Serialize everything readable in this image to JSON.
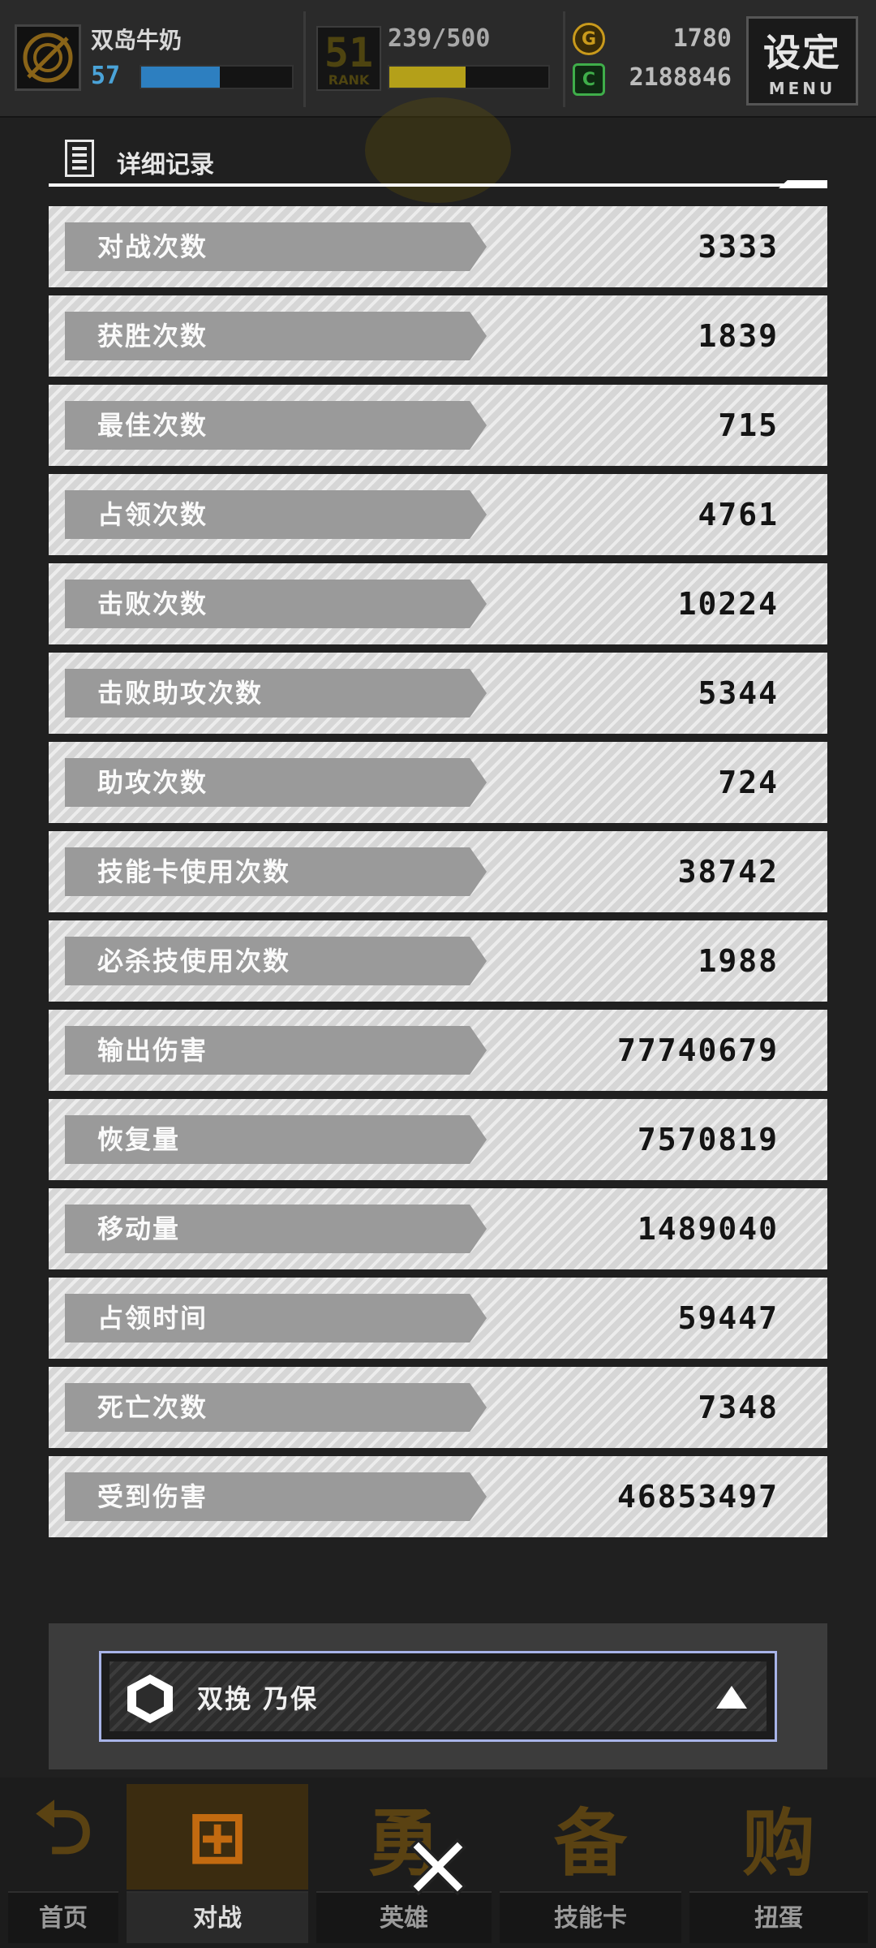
{
  "player": {
    "name": "双岛牛奶",
    "level": "57",
    "level_progress": 0.52
  },
  "rank": {
    "number": "51",
    "label": "RANK",
    "progress_text": "239/500",
    "progress": 0.478
  },
  "currency": {
    "gold": "1780",
    "credits": "2188846",
    "gold_icon": "coin-icon",
    "credits_icon": "green-credit-icon"
  },
  "menu": {
    "label": "设定",
    "sublabel": "MENU"
  },
  "section": {
    "title": "详细记录"
  },
  "stats": [
    {
      "label": "对战次数",
      "value": "3333"
    },
    {
      "label": "获胜次数",
      "value": "1839"
    },
    {
      "label": "最佳次数",
      "value": "715"
    },
    {
      "label": "占领次数",
      "value": "4761"
    },
    {
      "label": "击败次数",
      "value": "10224"
    },
    {
      "label": "击败助攻次数",
      "value": "5344"
    },
    {
      "label": "助攻次数",
      "value": "724"
    },
    {
      "label": "技能卡使用次数",
      "value": "38742"
    },
    {
      "label": "必杀技使用次数",
      "value": "1988"
    },
    {
      "label": "输出伤害",
      "value": "77740679"
    },
    {
      "label": "恢复量",
      "value": "7570819"
    },
    {
      "label": "移动量",
      "value": "1489040"
    },
    {
      "label": "占领时间",
      "value": "59447"
    },
    {
      "label": "死亡次数",
      "value": "7348"
    },
    {
      "label": "受到伤害",
      "value": "46853497"
    }
  ],
  "selector": {
    "character": "双挽 乃保"
  },
  "nav": [
    {
      "label": "首页",
      "glyph": "⮌"
    },
    {
      "label": "对战",
      "glyph": "⊞"
    },
    {
      "label": "英雄",
      "glyph": "勇"
    },
    {
      "label": "技能卡",
      "glyph": "备"
    },
    {
      "label": "扭蛋",
      "glyph": "购"
    }
  ],
  "colors": {
    "level_bar": "#2d7fc0",
    "rank_bar": "#b4a019",
    "gold_coin": "#c99a1c",
    "credit": "#3fae4a",
    "selector_border": "#a8b4e8"
  }
}
